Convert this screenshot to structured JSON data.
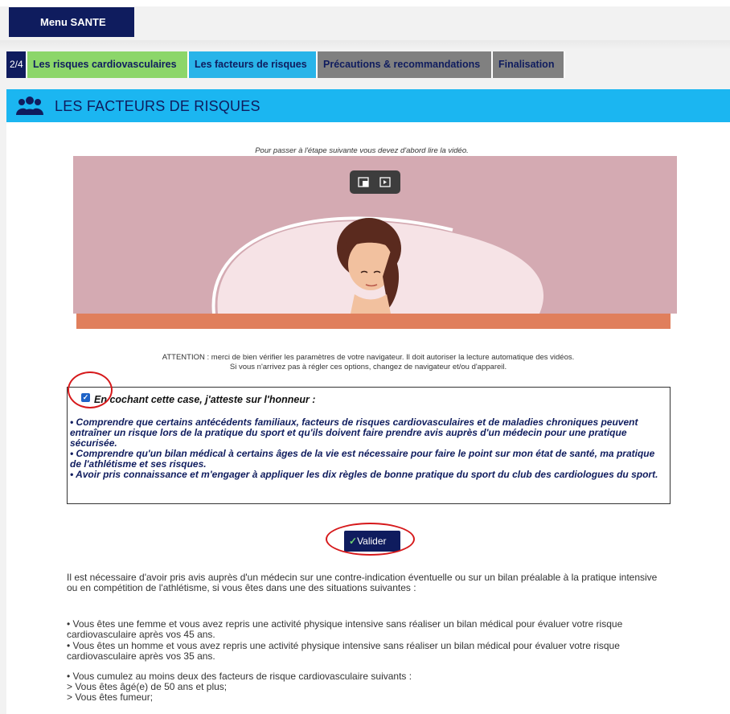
{
  "menu": {
    "label": "Menu SANTE"
  },
  "tabs": {
    "step": "2/4",
    "items": [
      {
        "label": "Les risques cardiovasculaires"
      },
      {
        "label": "Les facteurs de risques"
      },
      {
        "label": "Précautions & recommandations"
      },
      {
        "label": "Finalisation"
      }
    ]
  },
  "section": {
    "title": "LES FACTEURS DE RISQUES",
    "icon": "people-icon"
  },
  "video": {
    "note": "Pour passer à l'étape suivante vous devez d'abord lire la vidéo.",
    "controls": [
      "exit-fullscreen-icon",
      "picture-in-picture-icon"
    ]
  },
  "attention": {
    "line1": "ATTENTION : merci de bien vérifier les paramètres de votre navigateur. Il doit autoriser la lecture automatique des vidéos.",
    "line2": "Si vous n'arrivez pas à régler ces options, changez de navigateur et/ou d'appareil."
  },
  "honor": {
    "checked": true,
    "title": "En cochant cette case, j'atteste sur l'honneur :",
    "items": [
      "• Comprendre que certains antécédents familiaux, facteurs de risques cardiovasculaires et de maladies chroniques peuvent entraîner un risque lors de la pratique du sport et qu'ils doivent faire prendre avis auprès d'un médecin pour une pratique sécurisée.",
      "• Comprendre qu'un bilan médical à certains âges de la vie est nécessaire pour faire le point sur mon état de santé, ma pratique de l'athlétisme et ses risques.",
      "• Avoir pris connaissance et m'engager à appliquer les dix règles de bonne pratique du sport du club des cardiologues du sport."
    ]
  },
  "validate": {
    "label": "Valider"
  },
  "info": {
    "intro": "Il est nécessaire d'avoir pris avis auprès d'un médecin sur une contre-indication éventuelle ou sur un bilan préalable à la pratique intensive ou en compétition de l'athlétisme, si vous êtes dans une des situations suivantes :",
    "case1": "• Vous êtes une femme et vous avez repris une activité physique intensive sans réaliser un bilan médical pour évaluer votre risque cardiovasculaire après vos 45 ans.",
    "case2": "• Vous êtes un homme et vous avez repris une activité physique intensive sans réaliser un bilan médical pour évaluer votre risque cardiovasculaire après vos 35 ans.",
    "case3": "• Vous cumulez au moins deux des facteurs de risque cardiovasculaire suivants :",
    "sub1": "> Vous êtes âgé(e) de 50 ans et plus;",
    "sub2": "> Vous êtes fumeur;"
  }
}
